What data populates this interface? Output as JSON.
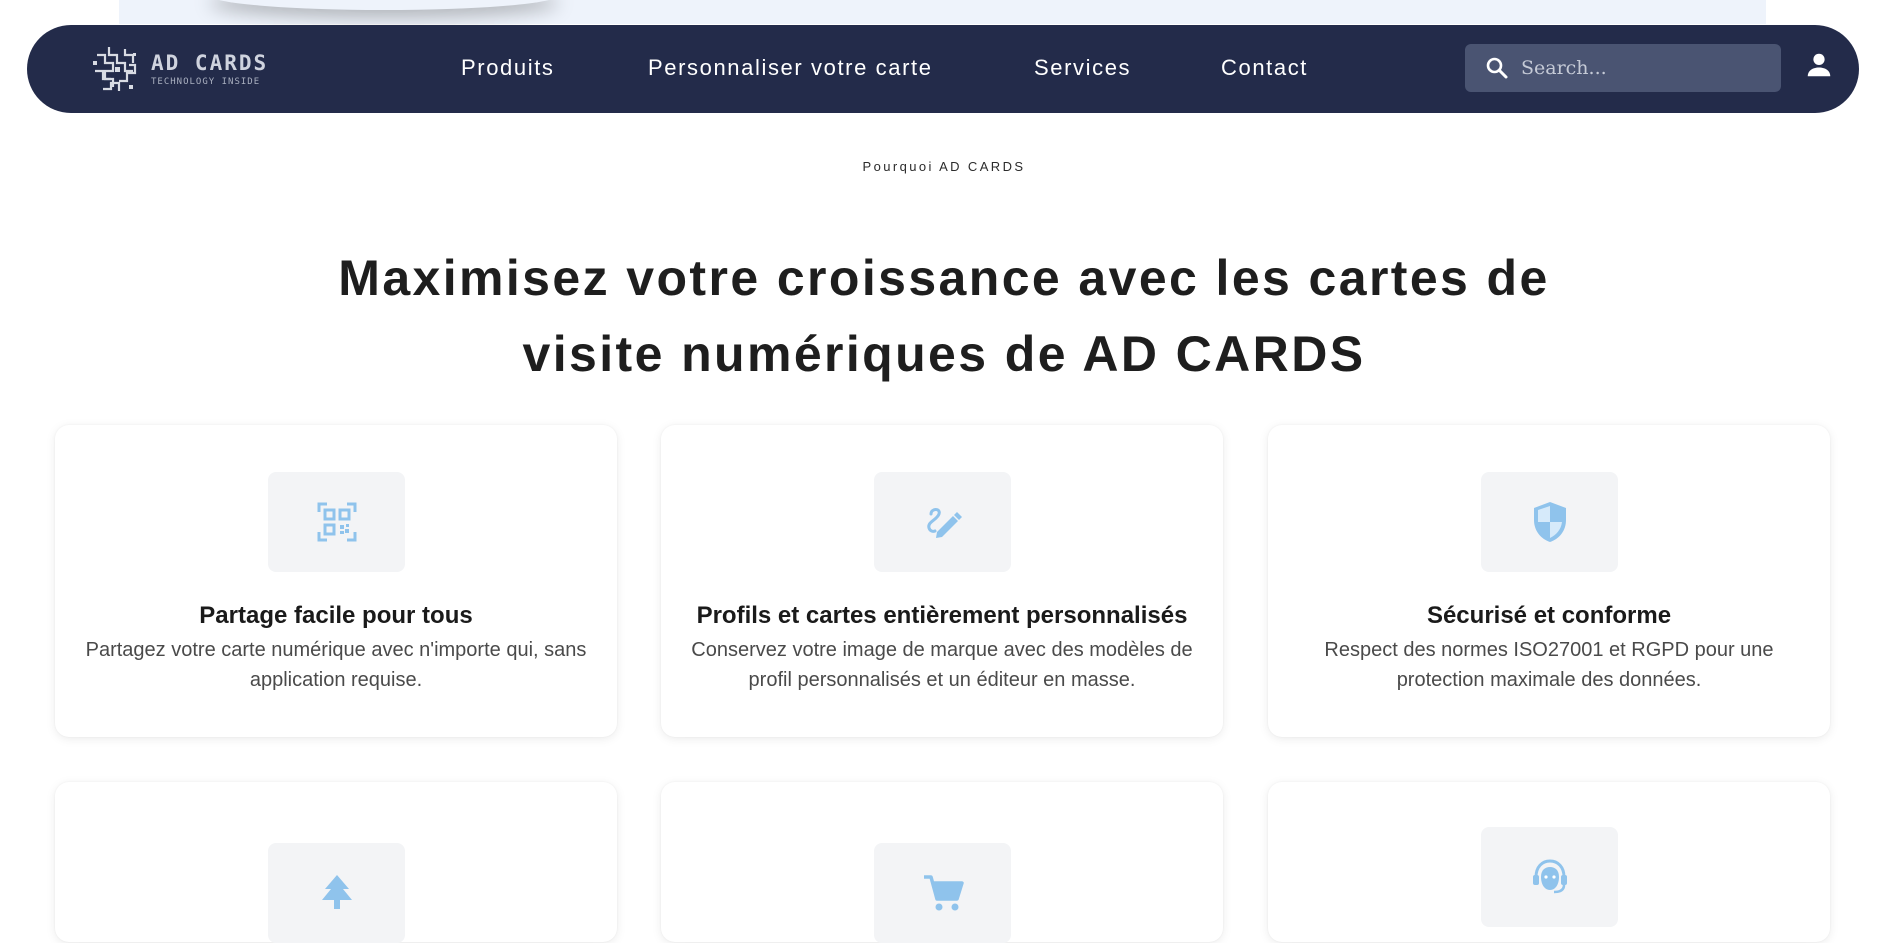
{
  "header": {
    "logo": {
      "title": "AD CARDS",
      "subtitle": "TECHNOLOGY INSIDE"
    },
    "nav": [
      {
        "label": "Produits"
      },
      {
        "label": "Personnaliser votre carte"
      },
      {
        "label": "Services"
      },
      {
        "label": "Contact"
      }
    ],
    "search": {
      "placeholder": "Search...",
      "value": "",
      "icon": "search-icon"
    },
    "user_icon": "user-icon"
  },
  "hero": {
    "eyebrow": "Pourquoi AD CARDS",
    "headline": "Maximisez votre croissance avec les cartes de visite numériques de AD CARDS"
  },
  "features": [
    {
      "icon": "qr-code-icon",
      "title": "Partage facile pour tous",
      "description": "Partagez votre carte numérique avec n'importe qui, sans application requise."
    },
    {
      "icon": "edit-pencil-icon",
      "title": "Profils et cartes entièrement personnalisés",
      "description": "Conservez votre image de marque avec des modèles de profil personnalisés et un éditeur en masse."
    },
    {
      "icon": "shield-icon",
      "title": "Sécurisé et conforme",
      "description": "Respect des normes ISO27001 et RGPD pour une protection maximale des données."
    },
    {
      "icon": "tree-icon",
      "title": "",
      "description": ""
    },
    {
      "icon": "shopping-cart-icon",
      "title": "",
      "description": ""
    },
    {
      "icon": "support-agent-icon",
      "title": "",
      "description": ""
    }
  ],
  "colors": {
    "navbar": "#232b4a",
    "accent_icon": "#8fc3ec",
    "search_bg": "#4a5472"
  }
}
